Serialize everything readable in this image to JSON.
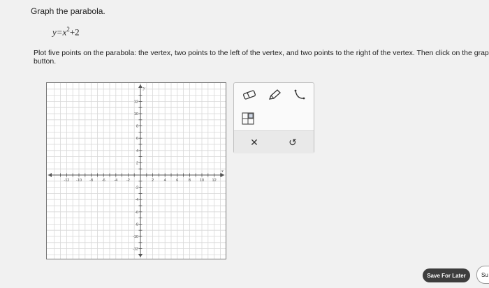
{
  "question": {
    "title": "Graph the parabola.",
    "equation": {
      "lhs": "y=x",
      "exponent": "2",
      "rhs": "+2"
    },
    "instructions_line1": "Plot five points on the parabola: the vertex, two points to the left of the vertex, and two points to the right of the vertex. Then click on the grap",
    "instructions_line2": "button."
  },
  "graph": {
    "x_min": -14,
    "x_max": 14,
    "y_min": -14,
    "y_max": 14,
    "x_axis_label": "x",
    "y_axis_label": "y",
    "x_tick_labels": [
      "-12",
      "-10",
      "-8",
      "-6",
      "-4",
      "-2",
      "2",
      "4",
      "6",
      "8",
      "10",
      "12"
    ],
    "y_tick_labels": [
      "12",
      "10",
      "8",
      "6",
      "4",
      "2",
      "-2",
      "-4",
      "-6",
      "-8",
      "-10",
      "-12"
    ],
    "grid": true
  },
  "tools": {
    "items": [
      {
        "name": "eraser-icon"
      },
      {
        "name": "pencil-icon"
      },
      {
        "name": "parabola-tool-icon"
      },
      {
        "name": "grid-select-icon"
      }
    ],
    "clear_symbol": "✕",
    "undo_symbol": "↺"
  },
  "footer": {
    "save_label": "Save For Later",
    "submit_label": "Su"
  },
  "colors": {
    "axis": "#555555",
    "grid": "#d8d8d8",
    "button_dark": "#3d3d3d"
  }
}
